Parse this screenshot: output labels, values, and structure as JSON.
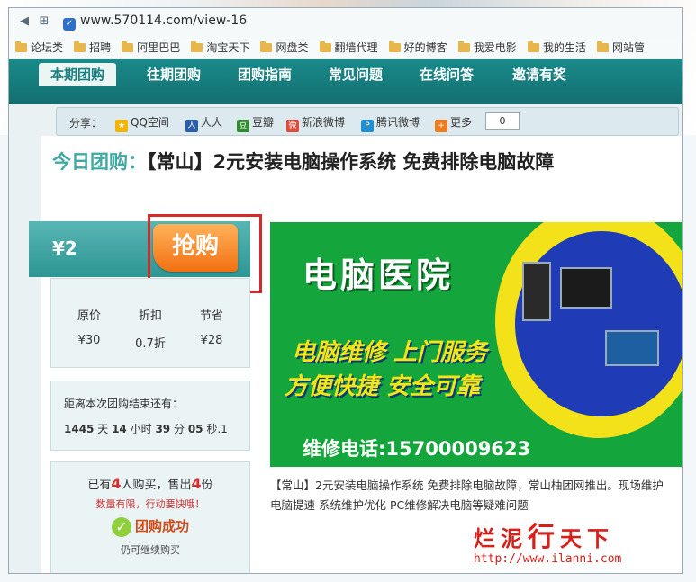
{
  "browser": {
    "url": "www.570114.com/view-16",
    "bookmarks": [
      "论坛类",
      "招聘",
      "阿里巴巴",
      "淘宝天下",
      "网盘类",
      "翻墙代理",
      "好的博客",
      "我爱电影",
      "我的生活",
      "网站管"
    ]
  },
  "nav": {
    "tabs": [
      "本期团购",
      "往期团购",
      "团购指南",
      "常见问题",
      "在线问答",
      "邀请有奖"
    ],
    "active": "本期团购"
  },
  "share": {
    "label": "分享：",
    "items": [
      {
        "label": "QQ空间",
        "icon": "qzone-icon"
      },
      {
        "label": "人人",
        "icon": "renren-icon"
      },
      {
        "label": "豆瓣",
        "icon": "douban-icon"
      },
      {
        "label": "新浪微博",
        "icon": "weibo-icon"
      },
      {
        "label": "腾讯微博",
        "icon": "tencent-weibo-icon"
      },
      {
        "label": "更多",
        "icon": "more-icon"
      }
    ],
    "count": "0"
  },
  "deal": {
    "title_prefix": "今日团购：",
    "title": "【常山】2元安装电脑操作系统 免费排除电脑故障",
    "price": "¥2",
    "buy_label": "抢购",
    "stats": [
      {
        "label": "原价",
        "value": "¥30"
      },
      {
        "label": "折扣",
        "value": "0.7折"
      },
      {
        "label": "节省",
        "value": "¥28"
      }
    ],
    "countdown_label": "距离本次团购结束还有：",
    "countdown": {
      "days": "1445",
      "days_unit": "天",
      "hours": "14",
      "hours_unit": "小时",
      "minutes": "39",
      "minutes_unit": "分",
      "seconds": "05",
      "seconds_unit": "秒.1"
    },
    "sold": {
      "pre": "已有",
      "buyers": "4",
      "mid": "人购买，售出",
      "count": "4",
      "post": "份"
    },
    "limited": "数量有限，行动要快哦！",
    "success": "团购成功",
    "can_buy": "仍可继续购买",
    "ad": {
      "heading": "电脑医院",
      "slogan1": "电脑维修 上门服务",
      "slogan2": "方便快捷 安全可靠",
      "phone_label": "维修电话:",
      "phone": "15700009623"
    },
    "description": "【常山】2元安装电脑操作系统 免费排除电脑故障，常山柚团网推出。现场维护 电脑提速 系统维护优化 PC维修解决电脑等疑难问题"
  },
  "watermark": {
    "text1": "烂泥",
    "text2": "行",
    "text3": "天下",
    "url": "http://www.ilanni.com"
  },
  "colors": {
    "nav": "#1a8a8a",
    "accent": "#41a8a4",
    "buy": "#f37012",
    "highlight_box": "#d52b2b"
  }
}
